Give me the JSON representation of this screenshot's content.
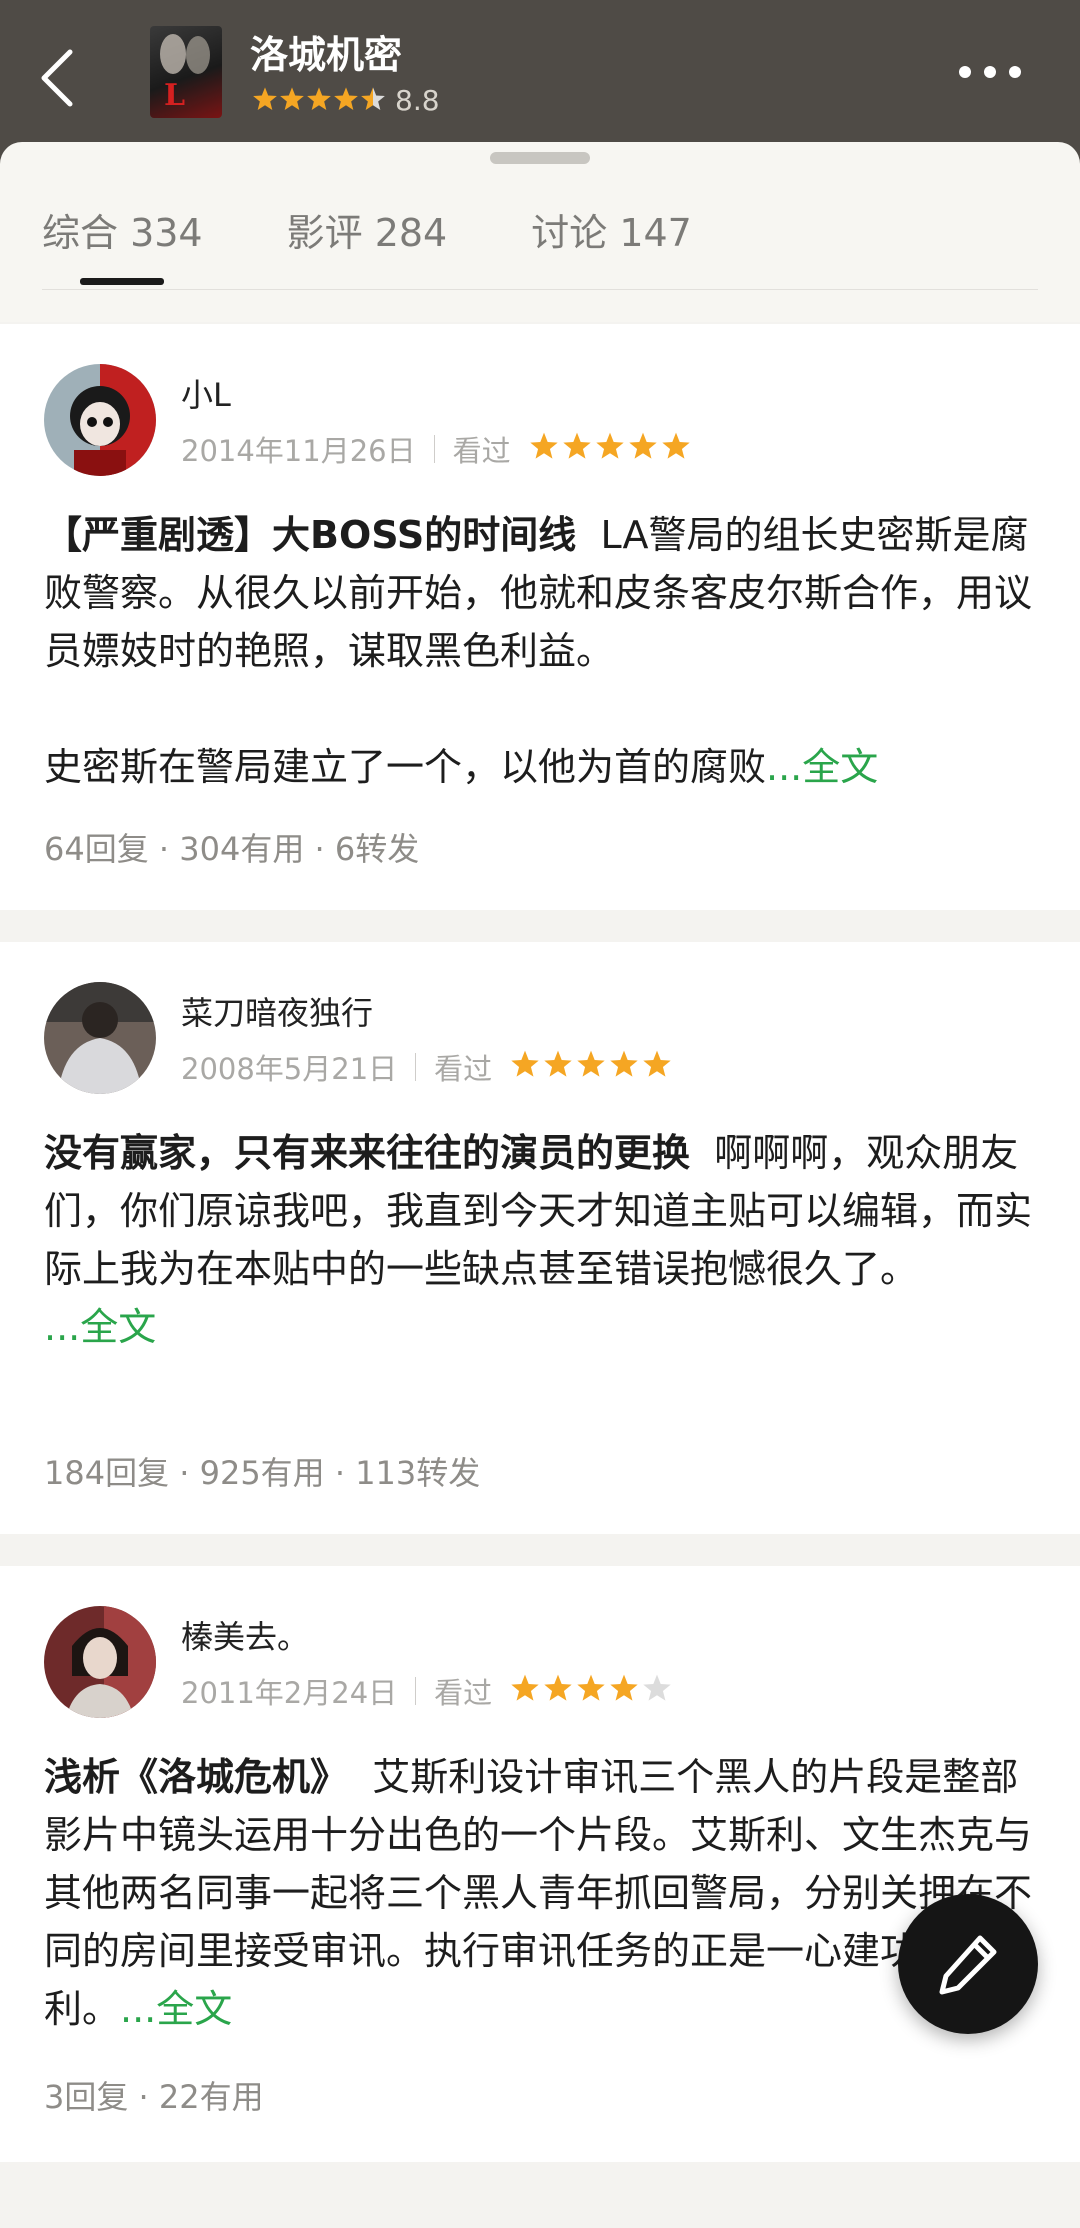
{
  "header": {
    "title": "洛城机密",
    "rating_value": "8.8",
    "rating_stars": 4.5,
    "back_icon": "chevron-left-icon",
    "more_icon": "more-dots-icon"
  },
  "tabs": [
    {
      "label": "综合 334"
    },
    {
      "label": "影评 284"
    },
    {
      "label": "讨论 147"
    }
  ],
  "reviews": [
    {
      "author": "小L",
      "date": "2014年11月26日",
      "status": "看过",
      "stars": 5,
      "title": "【严重剧透】大BOSS的时间线",
      "body": "LA警局的组长史密斯是腐败警察。从很久以前开始，他就和皮条客皮尔斯合作，用议员嫖妓时的艳照，谋取黑色利益。",
      "body2": "史密斯在警局建立了一个，以他为首的腐败",
      "more": "...全文",
      "stats": "64回复 · 304有用 · 6转发"
    },
    {
      "author": "菜刀暗夜独行",
      "date": "2008年5月21日",
      "status": "看过",
      "stars": 5,
      "title": "没有赢家，只有来来往往的演员的更换",
      "body": "啊啊啊，观众朋友们，你们原谅我吧，我直到今天才知道主贴可以编辑，而实际上我为在本贴中的一些缺点甚至错误抱憾很久了。",
      "more": "...全文",
      "stats": "184回复 · 925有用 · 113转发"
    },
    {
      "author": "榛美去。",
      "date": "2011年2月24日",
      "status": "看过",
      "stars": 4,
      "title": "浅析《洛城危机》",
      "body": "艾斯利设计审讯三个黑人的片段是整部影片中镜头运用十分出色的一个片段。艾斯利、文生杰克与其他两名同事一起将三个黑人青年抓回警局，分别关押在不同的房间里接受审讯。执行审讯任务的正是一心建功的艾斯利。",
      "more": "...全文",
      "stats": "3回复 · 22有用"
    }
  ],
  "fab_icon": "pencil-icon",
  "colors": {
    "header_bg": "#4f4b46",
    "star": "#f5a623",
    "star_empty": "#dcdcdc",
    "link_green": "#2aa54b"
  }
}
